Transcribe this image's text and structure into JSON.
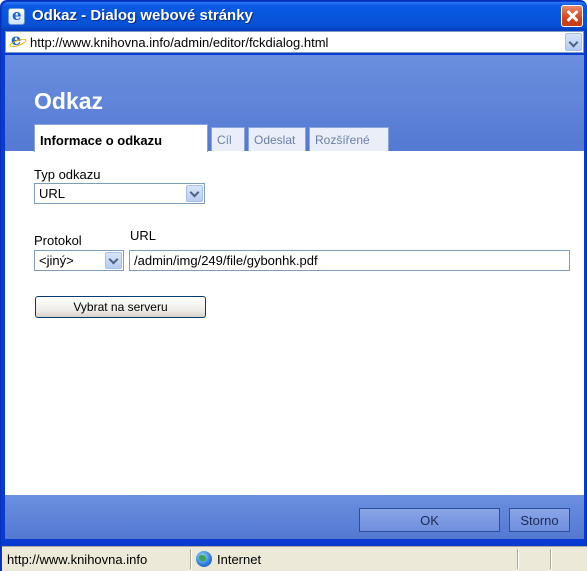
{
  "window": {
    "title": "Odkaz - Dialog webové stránky",
    "address": "http://www.knihovna.info/admin/editor/fckdialog.html"
  },
  "dialog": {
    "title": "Odkaz",
    "tabs": [
      {
        "label": "Informace o odkazu",
        "active": true
      },
      {
        "label": "Cíl",
        "active": false
      },
      {
        "label": "Odeslat",
        "active": false
      },
      {
        "label": "Rozšířené",
        "active": false
      }
    ],
    "link_type": {
      "label": "Typ odkazu",
      "value": "URL"
    },
    "protocol": {
      "label": "Protokol",
      "value": "<jiný>"
    },
    "url": {
      "label": "URL",
      "value": "/admin/img/249/file/gybonhk.pdf"
    },
    "browse_server_label": "Vybrat na serveru",
    "ok_label": "OK",
    "cancel_label": "Storno"
  },
  "statusbar": {
    "url": "http://www.knihovna.info",
    "zone": "Internet"
  },
  "colors": {
    "titlebar": "#0856dc",
    "dialog_header": "#6a8fdf",
    "statusbar": "#ece9d8"
  }
}
